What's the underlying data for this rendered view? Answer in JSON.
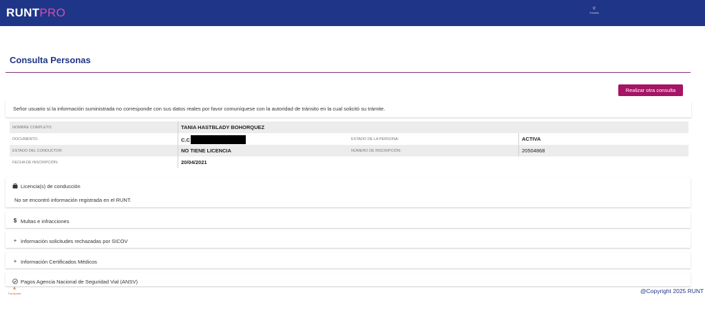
{
  "header": {
    "logo_main": "RUNT",
    "logo_accent": "PRO",
    "mini_text": "Transito"
  },
  "page": {
    "title": "Consulta Personas",
    "new_query_button": "Realizar otra consulta",
    "notice": "Señor usuario si la información suministrada no corresponde con sus datos reales por favor comuníquese con la autoridad de tránsito en la cual solicitó su trámite."
  },
  "person": {
    "name_label": "NOMBRE COMPLETO:",
    "name_value": "TANIA HASTBLADY BOHORQUEZ",
    "document_label": "DOCUMENTO:",
    "document_value": "C.C",
    "person_status_label": "ESTADO DE LA PERSONA:",
    "person_status_value": "ACTIVA",
    "driver_status_label": "ESTADO DEL CONDUCTOR:",
    "driver_status_value": "NO TIENE LICENCIA",
    "inscription_number_label": "NÚMERO DE INSCRIPCIÓN:",
    "inscription_number_value": "20504868",
    "inscription_date_label": "FECHA DE INSCRIPCIÓN:",
    "inscription_date_value": "20/04/2021"
  },
  "sections": {
    "licenses": {
      "icon": "briefcase-icon",
      "title": "Licencia(s) de conducción",
      "body": "No se encontró información registrada en el RUNT."
    },
    "fines": {
      "icon": "dollar-icon",
      "title": "Multas e infracciones"
    },
    "sicov": {
      "icon": "plus-icon",
      "title": "Información solicitudes rechazadas por SICOV"
    },
    "medical": {
      "icon": "plus-icon",
      "title": "Información Certificados Médicos"
    },
    "ansv": {
      "icon": "check-circle-icon",
      "title": "Pagos Agencia Nacional de Seguridad Vial (ANSV)"
    }
  },
  "footer": {
    "copyright": "@Copyright 2025 RUNT",
    "logo_text": "Transporte"
  },
  "colors": {
    "header_bg": "#1f3587",
    "accent_magenta": "#a51465",
    "title_blue": "#1f3587",
    "rule_purple": "#7a2e7e"
  }
}
